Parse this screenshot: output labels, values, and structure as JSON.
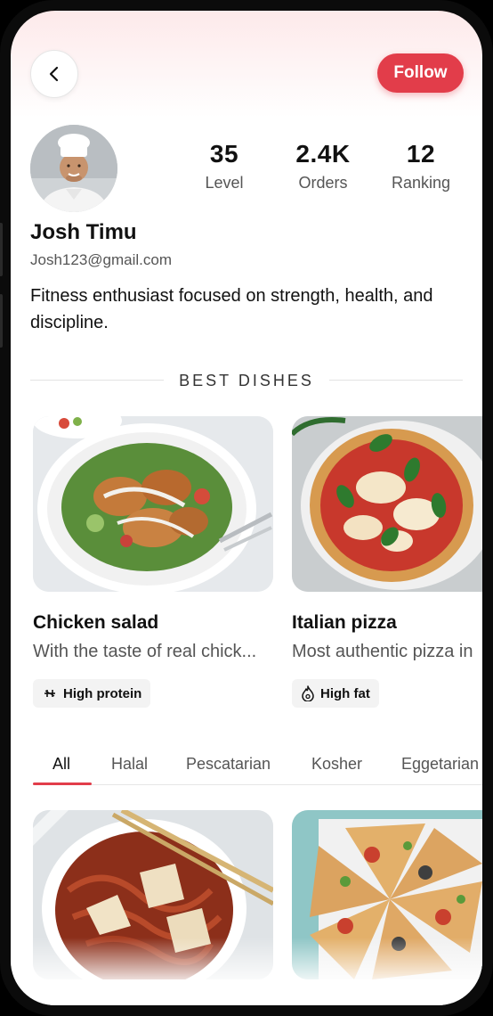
{
  "header": {
    "follow_label": "Follow"
  },
  "profile": {
    "name": "Josh Timu",
    "email": "Josh123@gmail.com",
    "bio": "Fitness enthusiast focused on strength, health, and discipline.",
    "stats": [
      {
        "value": "35",
        "label": "Level"
      },
      {
        "value": "2.4K",
        "label": "Orders"
      },
      {
        "value": "12",
        "label": "Ranking"
      }
    ]
  },
  "best_dishes": {
    "section_title": "BEST DISHES",
    "items": [
      {
        "title": "Chicken salad",
        "description": "With the taste of real chick...",
        "tag": "High protein",
        "tag_icon": "protein-icon"
      },
      {
        "title": "Italian pizza",
        "description": "Most authentic pizza in",
        "tag": "High fat",
        "tag_icon": "flame-icon"
      }
    ]
  },
  "tabs": [
    "All",
    "Halal",
    "Pescatarian",
    "Kosher",
    "Eggetarian"
  ],
  "colors": {
    "accent": "#e23d4a"
  }
}
